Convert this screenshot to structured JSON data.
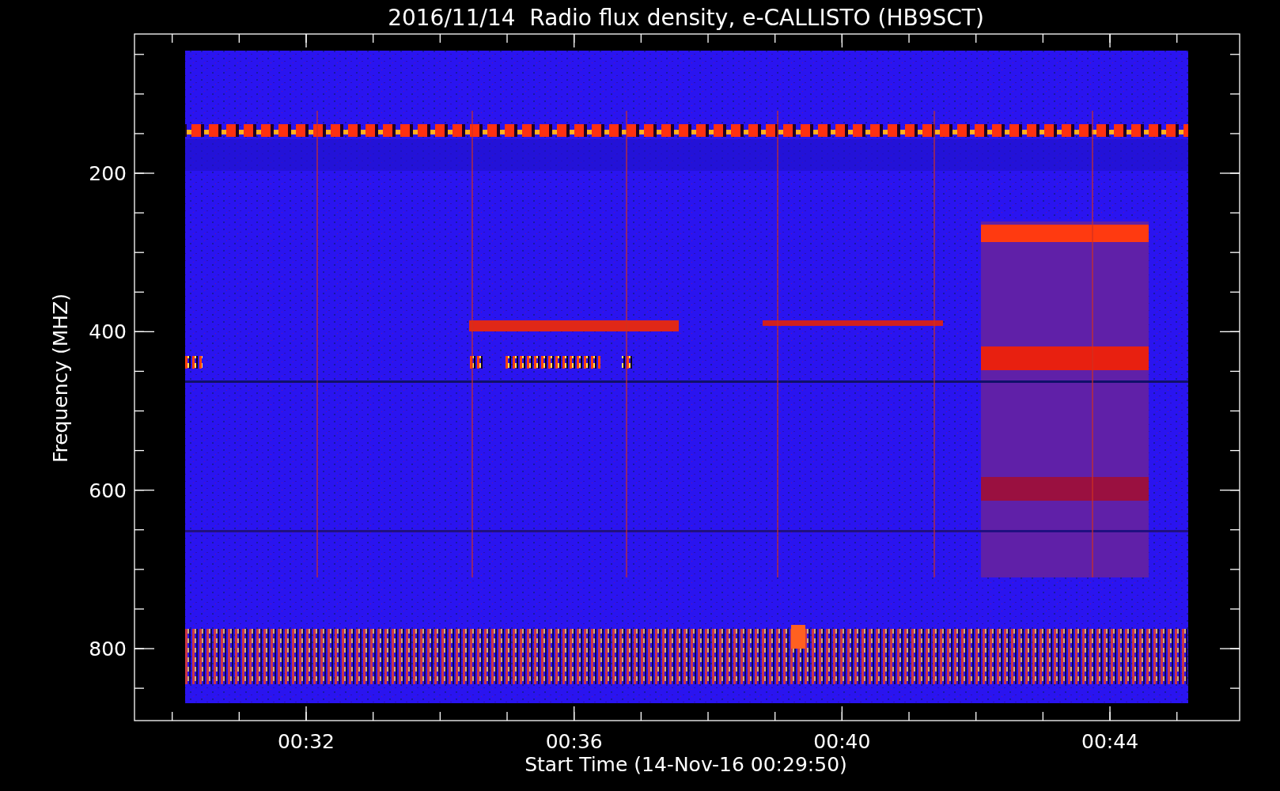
{
  "title": "2016/11/14  Radio flux density, e-CALLISTO (HB9SCT)",
  "y_axis": {
    "label": "Frequency (MHZ)",
    "ticks": [
      "200",
      "400",
      "600",
      "800"
    ]
  },
  "x_axis": {
    "label": "Start Time (14-Nov-16 00:29:50)",
    "ticks": [
      "00:32",
      "00:36",
      "00:40",
      "00:44"
    ]
  }
}
